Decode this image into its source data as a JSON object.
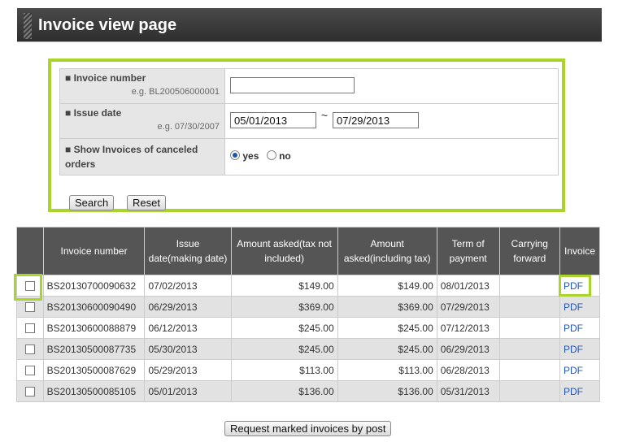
{
  "page_title": "Invoice view page",
  "colors": {
    "highlight": "#a8d42b",
    "header_bg": "#333333",
    "link": "#2255bb"
  },
  "search": {
    "invoice_number": {
      "label": "■ Invoice number",
      "example": "e.g. BL200506000001",
      "value": ""
    },
    "issue_date": {
      "label": "■ Issue date",
      "example": "e.g. 07/30/2007",
      "from": "05/01/2013",
      "separator": "~",
      "to": "07/29/2013"
    },
    "canceled": {
      "label": "■ Show Invoices of canceled orders",
      "options": [
        "yes",
        "no"
      ],
      "selected": "yes"
    },
    "search_label": "Search",
    "reset_label": "Reset"
  },
  "table": {
    "headers": [
      "",
      "Invoice number",
      "Issue date(making date)",
      "Amount asked(tax not included)",
      "Amount asked(including tax)",
      "Term of payment",
      "Carrying forward",
      "Invoice"
    ],
    "rows": [
      {
        "invoice": "BS20130700090632",
        "issue": "07/02/2013",
        "amount_ex": "$149.00",
        "amount_inc": "$149.00",
        "term": "08/01/2013",
        "carry": "",
        "link": "PDF"
      },
      {
        "invoice": "BS20130600090490",
        "issue": "06/29/2013",
        "amount_ex": "$369.00",
        "amount_inc": "$369.00",
        "term": "07/29/2013",
        "carry": "",
        "link": "PDF"
      },
      {
        "invoice": "BS20130600088879",
        "issue": "06/12/2013",
        "amount_ex": "$245.00",
        "amount_inc": "$245.00",
        "term": "07/12/2013",
        "carry": "",
        "link": "PDF"
      },
      {
        "invoice": "BS20130500087735",
        "issue": "05/30/2013",
        "amount_ex": "$245.00",
        "amount_inc": "$245.00",
        "term": "06/29/2013",
        "carry": "",
        "link": "PDF"
      },
      {
        "invoice": "BS20130500087629",
        "issue": "05/29/2013",
        "amount_ex": "$113.00",
        "amount_inc": "$113.00",
        "term": "06/28/2013",
        "carry": "",
        "link": "PDF"
      },
      {
        "invoice": "BS20130500085105",
        "issue": "05/01/2013",
        "amount_ex": "$136.00",
        "amount_inc": "$136.00",
        "term": "05/31/2013",
        "carry": "",
        "link": "PDF"
      }
    ]
  },
  "post_button_label": "Request marked invoices by post"
}
